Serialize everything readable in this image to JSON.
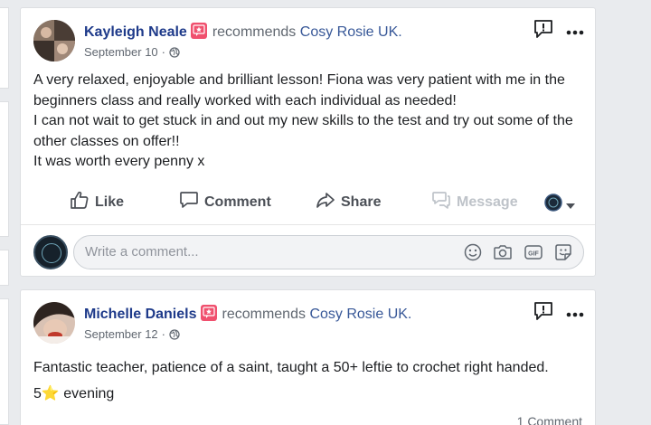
{
  "posts": [
    {
      "author": "Kayleigh Neale",
      "recommends_text": "recommends",
      "page_name": "Cosy Rosie UK.",
      "date": "September 10",
      "dot": "·",
      "body_lines": [
        "A very relaxed, enjoyable and brilliant lesson! Fiona was very patient with me in the",
        "beginners class and really worked with each individual as needed!",
        "I can not wait to get stuck in and out my new skills to the test and try out some of the",
        "other classes on offer!!",
        "It was worth every penny x"
      ],
      "actions": {
        "like": "Like",
        "comment": "Comment",
        "share": "Share",
        "message": "Message"
      },
      "comment_placeholder": "Write a comment..."
    },
    {
      "author": "Michelle Daniels",
      "recommends_text": "recommends",
      "page_name": "Cosy Rosie UK.",
      "date": "September 12",
      "dot": "·",
      "body_lines": [
        "Fantastic teacher, patience of a saint, taught a 50+ leftie to crochet right handed.",
        "5⭐ evening"
      ],
      "comment_count": "1 Comment"
    }
  ],
  "colors": {
    "name": "#1e3a8a",
    "badge": "#f0506e",
    "link": "#385898"
  }
}
